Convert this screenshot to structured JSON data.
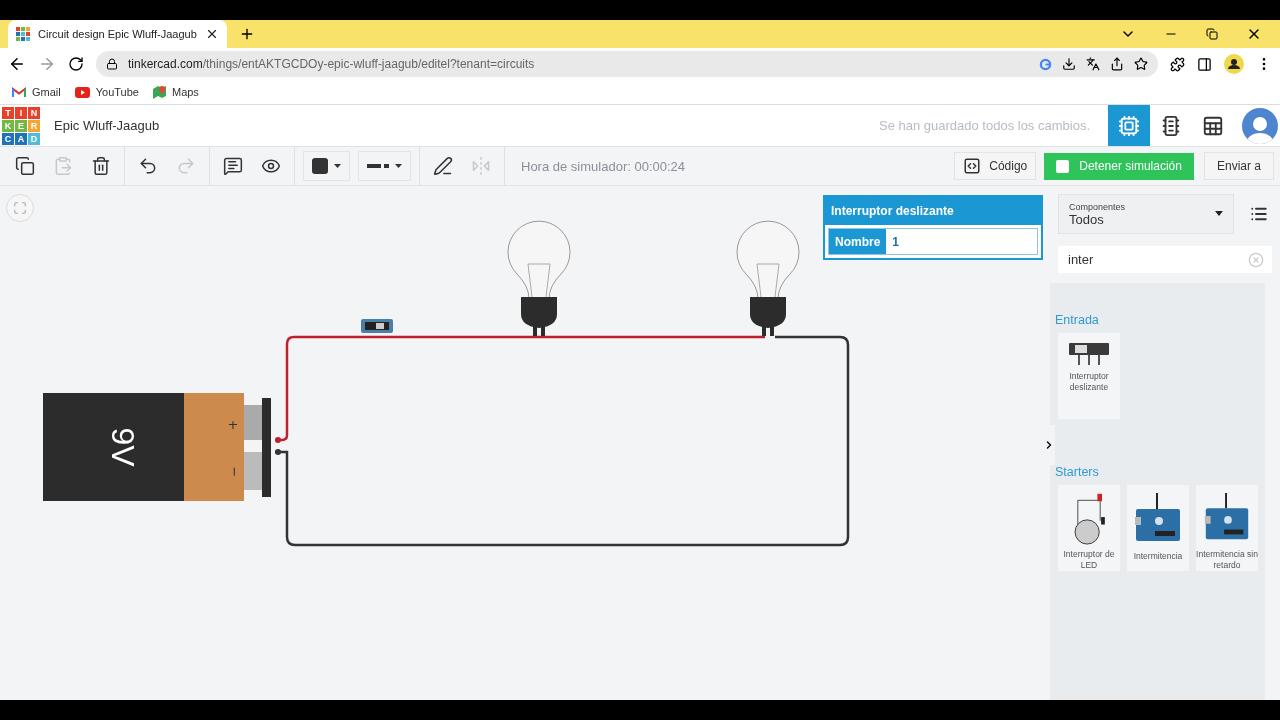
{
  "browser": {
    "tabs": [
      {
        "title": "Circuit design Epic Wluff-Jaagub",
        "selected": true
      }
    ],
    "url_host": "tinkercad.com",
    "url_path": "/things/entAKTGCDOy-epic-wluff-jaagub/editel?tenant=circuits",
    "bookmarks": [
      {
        "label": "Gmail",
        "kind": "mail"
      },
      {
        "label": "YouTube",
        "kind": "video"
      },
      {
        "label": "Maps",
        "kind": "map"
      }
    ]
  },
  "app": {
    "logo_letters": [
      "T",
      "I",
      "N",
      "K",
      "E",
      "R",
      "C",
      "A",
      "D"
    ],
    "design_title": "Epic Wluff-Jaagub",
    "save_status": "Se han guardado todos los cambios.",
    "views": [
      {
        "kind": "circuit",
        "selected": true
      },
      {
        "kind": "schematic",
        "selected": false
      },
      {
        "kind": "list",
        "selected": false
      }
    ]
  },
  "toolbar": {
    "tools": [
      {
        "kind": "copy",
        "disabled": false
      },
      {
        "kind": "paste",
        "disabled": true
      },
      {
        "kind": "delete",
        "disabled": false
      },
      {
        "kind": "undo",
        "disabled": false
      },
      {
        "kind": "redo",
        "disabled": true
      },
      {
        "kind": "note",
        "disabled": false
      },
      {
        "kind": "notes_view",
        "disabled": false
      },
      {
        "kind": "color",
        "disabled": false
      },
      {
        "kind": "line",
        "disabled": false
      },
      {
        "kind": "pen",
        "disabled": false
      },
      {
        "kind": "mirror",
        "disabled": true
      }
    ],
    "sim_time": "Hora de simulador: 00:00:24",
    "code_button": "Código",
    "stop_button": "Detener simulación",
    "send_button": "Enviar a"
  },
  "inspector": {
    "title": "Interruptor deslizante",
    "field_label": "Nombre",
    "field_value": "1"
  },
  "circuit": {
    "battery_label": "9V",
    "plus": "+",
    "minus": "−",
    "switch_on": true
  },
  "palette": {
    "filter_label": "Componentes",
    "filter_value": "Todos",
    "search_value": "inter",
    "sections": [
      {
        "title": "Entrada",
        "items": [
          {
            "label": "Interruptor deslizante",
            "kind": "switch"
          }
        ]
      },
      {
        "title": "Starters",
        "items": [
          {
            "label": "Interruptor de LED",
            "kind": "led_circuit"
          },
          {
            "label": "Intermitencia",
            "kind": "arduino"
          },
          {
            "label": "Intermitencia sin retardo",
            "kind": "arduino"
          }
        ]
      }
    ]
  }
}
